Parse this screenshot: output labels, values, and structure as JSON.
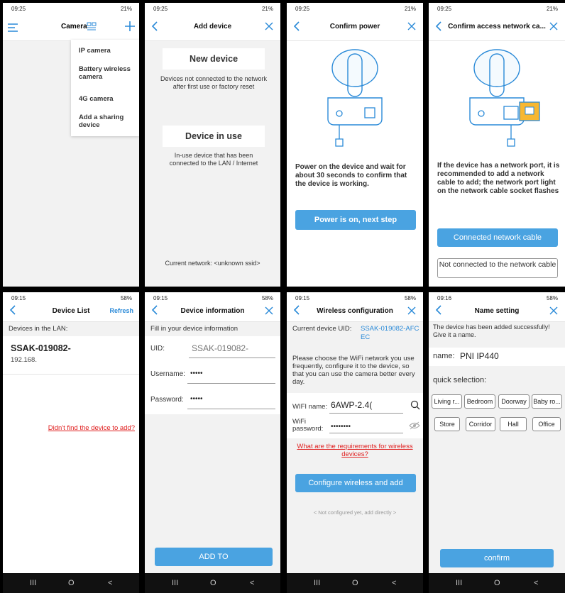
{
  "s1": {
    "time": "09:25",
    "status": "21%",
    "title": "Camera",
    "menu": [
      "IP camera",
      "Battery wireless camera",
      "4G camera",
      "Add a sharing device"
    ]
  },
  "s2": {
    "time": "09:25",
    "status": "21%",
    "title": "Add device",
    "new_title": "New device",
    "new_desc": "Devices not connected to the network after first use or factory reset",
    "inuse_title": "Device in use",
    "inuse_desc": "In-use device that has been connected to the LAN / Internet",
    "network": "Current network: <unknown ssid>"
  },
  "s3": {
    "time": "09:25",
    "status": "21%",
    "title": "Confirm power",
    "desc": "Power on the device and wait for about 30 seconds to confirm that the device is working.",
    "button": "Power is on, next step"
  },
  "s4": {
    "time": "09:25",
    "status": "21%",
    "title": "Confirm access network ca...",
    "desc": "If the device has a network port, it is recommended to add a network cable to add; the network port light on the network cable socket flashes",
    "btn_connected": "Connected network cable",
    "btn_not": "Not connected to the network cable"
  },
  "s5": {
    "time": "09:15",
    "status": "58%",
    "title": "Device List",
    "refresh": "Refresh",
    "section": "Devices in the LAN:",
    "device_name": "SSAK-019082-",
    "device_ip": "192.168.",
    "link": "Didn't find the device to add?"
  },
  "s6": {
    "time": "09:15",
    "status": "58%",
    "title": "Device information",
    "section": "Fill in your device information",
    "uid_label": "UID:",
    "uid_value": "SSAK-019082-",
    "user_label": "Username:",
    "user_value": "•••••",
    "pass_label": "Password:",
    "pass_value": "•••••",
    "button": "ADD TO"
  },
  "s7": {
    "time": "09:15",
    "status": "58%",
    "title": "Wireless configuration",
    "uid_label": "Current device UID:",
    "uid_value": "SSAK-019082-AFCEC",
    "desc": "Please choose the WiFi network you use frequently, configure it to the device, so that you can use the camera better every day.",
    "wifi_label": "WIFI name:",
    "wifi_value": "6AWP-2.4(",
    "pass_label": "WiFi password:",
    "pass_value": "••••••••",
    "link": "What are the requirements for wireless devices?",
    "button": "Configure wireless and add",
    "skip": "< Not configured yet, add directly >"
  },
  "s8": {
    "time": "09:16",
    "status": "58%",
    "title": "Name setting",
    "desc": "The device has been added successfully! Give it a name.",
    "name_label": "name:",
    "name_value": "PNI IP440",
    "quick": "quick selection:",
    "tags": [
      "Living r...",
      "Bedroom",
      "Doorway",
      "Baby ro...",
      "Store",
      "Corridor",
      "Hall",
      "Office"
    ],
    "button": "confirm"
  },
  "nav": {
    "recent": "III",
    "home": "O",
    "back": "<"
  },
  "colors": {
    "accent": "#4aa3e1",
    "link_red": "#e02020",
    "icon_blue": "#2a8ad8"
  }
}
